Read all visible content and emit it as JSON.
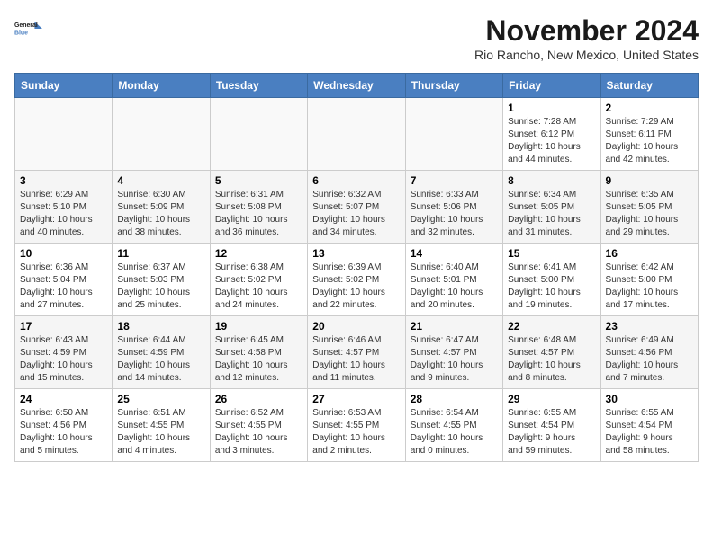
{
  "header": {
    "logo_line1": "General",
    "logo_line2": "Blue",
    "month": "November 2024",
    "location": "Rio Rancho, New Mexico, United States"
  },
  "weekdays": [
    "Sunday",
    "Monday",
    "Tuesday",
    "Wednesday",
    "Thursday",
    "Friday",
    "Saturday"
  ],
  "weeks": [
    [
      {
        "day": "",
        "info": ""
      },
      {
        "day": "",
        "info": ""
      },
      {
        "day": "",
        "info": ""
      },
      {
        "day": "",
        "info": ""
      },
      {
        "day": "",
        "info": ""
      },
      {
        "day": "1",
        "info": "Sunrise: 7:28 AM\nSunset: 6:12 PM\nDaylight: 10 hours\nand 44 minutes."
      },
      {
        "day": "2",
        "info": "Sunrise: 7:29 AM\nSunset: 6:11 PM\nDaylight: 10 hours\nand 42 minutes."
      }
    ],
    [
      {
        "day": "3",
        "info": "Sunrise: 6:29 AM\nSunset: 5:10 PM\nDaylight: 10 hours\nand 40 minutes."
      },
      {
        "day": "4",
        "info": "Sunrise: 6:30 AM\nSunset: 5:09 PM\nDaylight: 10 hours\nand 38 minutes."
      },
      {
        "day": "5",
        "info": "Sunrise: 6:31 AM\nSunset: 5:08 PM\nDaylight: 10 hours\nand 36 minutes."
      },
      {
        "day": "6",
        "info": "Sunrise: 6:32 AM\nSunset: 5:07 PM\nDaylight: 10 hours\nand 34 minutes."
      },
      {
        "day": "7",
        "info": "Sunrise: 6:33 AM\nSunset: 5:06 PM\nDaylight: 10 hours\nand 32 minutes."
      },
      {
        "day": "8",
        "info": "Sunrise: 6:34 AM\nSunset: 5:05 PM\nDaylight: 10 hours\nand 31 minutes."
      },
      {
        "day": "9",
        "info": "Sunrise: 6:35 AM\nSunset: 5:05 PM\nDaylight: 10 hours\nand 29 minutes."
      }
    ],
    [
      {
        "day": "10",
        "info": "Sunrise: 6:36 AM\nSunset: 5:04 PM\nDaylight: 10 hours\nand 27 minutes."
      },
      {
        "day": "11",
        "info": "Sunrise: 6:37 AM\nSunset: 5:03 PM\nDaylight: 10 hours\nand 25 minutes."
      },
      {
        "day": "12",
        "info": "Sunrise: 6:38 AM\nSunset: 5:02 PM\nDaylight: 10 hours\nand 24 minutes."
      },
      {
        "day": "13",
        "info": "Sunrise: 6:39 AM\nSunset: 5:02 PM\nDaylight: 10 hours\nand 22 minutes."
      },
      {
        "day": "14",
        "info": "Sunrise: 6:40 AM\nSunset: 5:01 PM\nDaylight: 10 hours\nand 20 minutes."
      },
      {
        "day": "15",
        "info": "Sunrise: 6:41 AM\nSunset: 5:00 PM\nDaylight: 10 hours\nand 19 minutes."
      },
      {
        "day": "16",
        "info": "Sunrise: 6:42 AM\nSunset: 5:00 PM\nDaylight: 10 hours\nand 17 minutes."
      }
    ],
    [
      {
        "day": "17",
        "info": "Sunrise: 6:43 AM\nSunset: 4:59 PM\nDaylight: 10 hours\nand 15 minutes."
      },
      {
        "day": "18",
        "info": "Sunrise: 6:44 AM\nSunset: 4:59 PM\nDaylight: 10 hours\nand 14 minutes."
      },
      {
        "day": "19",
        "info": "Sunrise: 6:45 AM\nSunset: 4:58 PM\nDaylight: 10 hours\nand 12 minutes."
      },
      {
        "day": "20",
        "info": "Sunrise: 6:46 AM\nSunset: 4:57 PM\nDaylight: 10 hours\nand 11 minutes."
      },
      {
        "day": "21",
        "info": "Sunrise: 6:47 AM\nSunset: 4:57 PM\nDaylight: 10 hours\nand 9 minutes."
      },
      {
        "day": "22",
        "info": "Sunrise: 6:48 AM\nSunset: 4:57 PM\nDaylight: 10 hours\nand 8 minutes."
      },
      {
        "day": "23",
        "info": "Sunrise: 6:49 AM\nSunset: 4:56 PM\nDaylight: 10 hours\nand 7 minutes."
      }
    ],
    [
      {
        "day": "24",
        "info": "Sunrise: 6:50 AM\nSunset: 4:56 PM\nDaylight: 10 hours\nand 5 minutes."
      },
      {
        "day": "25",
        "info": "Sunrise: 6:51 AM\nSunset: 4:55 PM\nDaylight: 10 hours\nand 4 minutes."
      },
      {
        "day": "26",
        "info": "Sunrise: 6:52 AM\nSunset: 4:55 PM\nDaylight: 10 hours\nand 3 minutes."
      },
      {
        "day": "27",
        "info": "Sunrise: 6:53 AM\nSunset: 4:55 PM\nDaylight: 10 hours\nand 2 minutes."
      },
      {
        "day": "28",
        "info": "Sunrise: 6:54 AM\nSunset: 4:55 PM\nDaylight: 10 hours\nand 0 minutes."
      },
      {
        "day": "29",
        "info": "Sunrise: 6:55 AM\nSunset: 4:54 PM\nDaylight: 9 hours\nand 59 minutes."
      },
      {
        "day": "30",
        "info": "Sunrise: 6:55 AM\nSunset: 4:54 PM\nDaylight: 9 hours\nand 58 minutes."
      }
    ]
  ]
}
